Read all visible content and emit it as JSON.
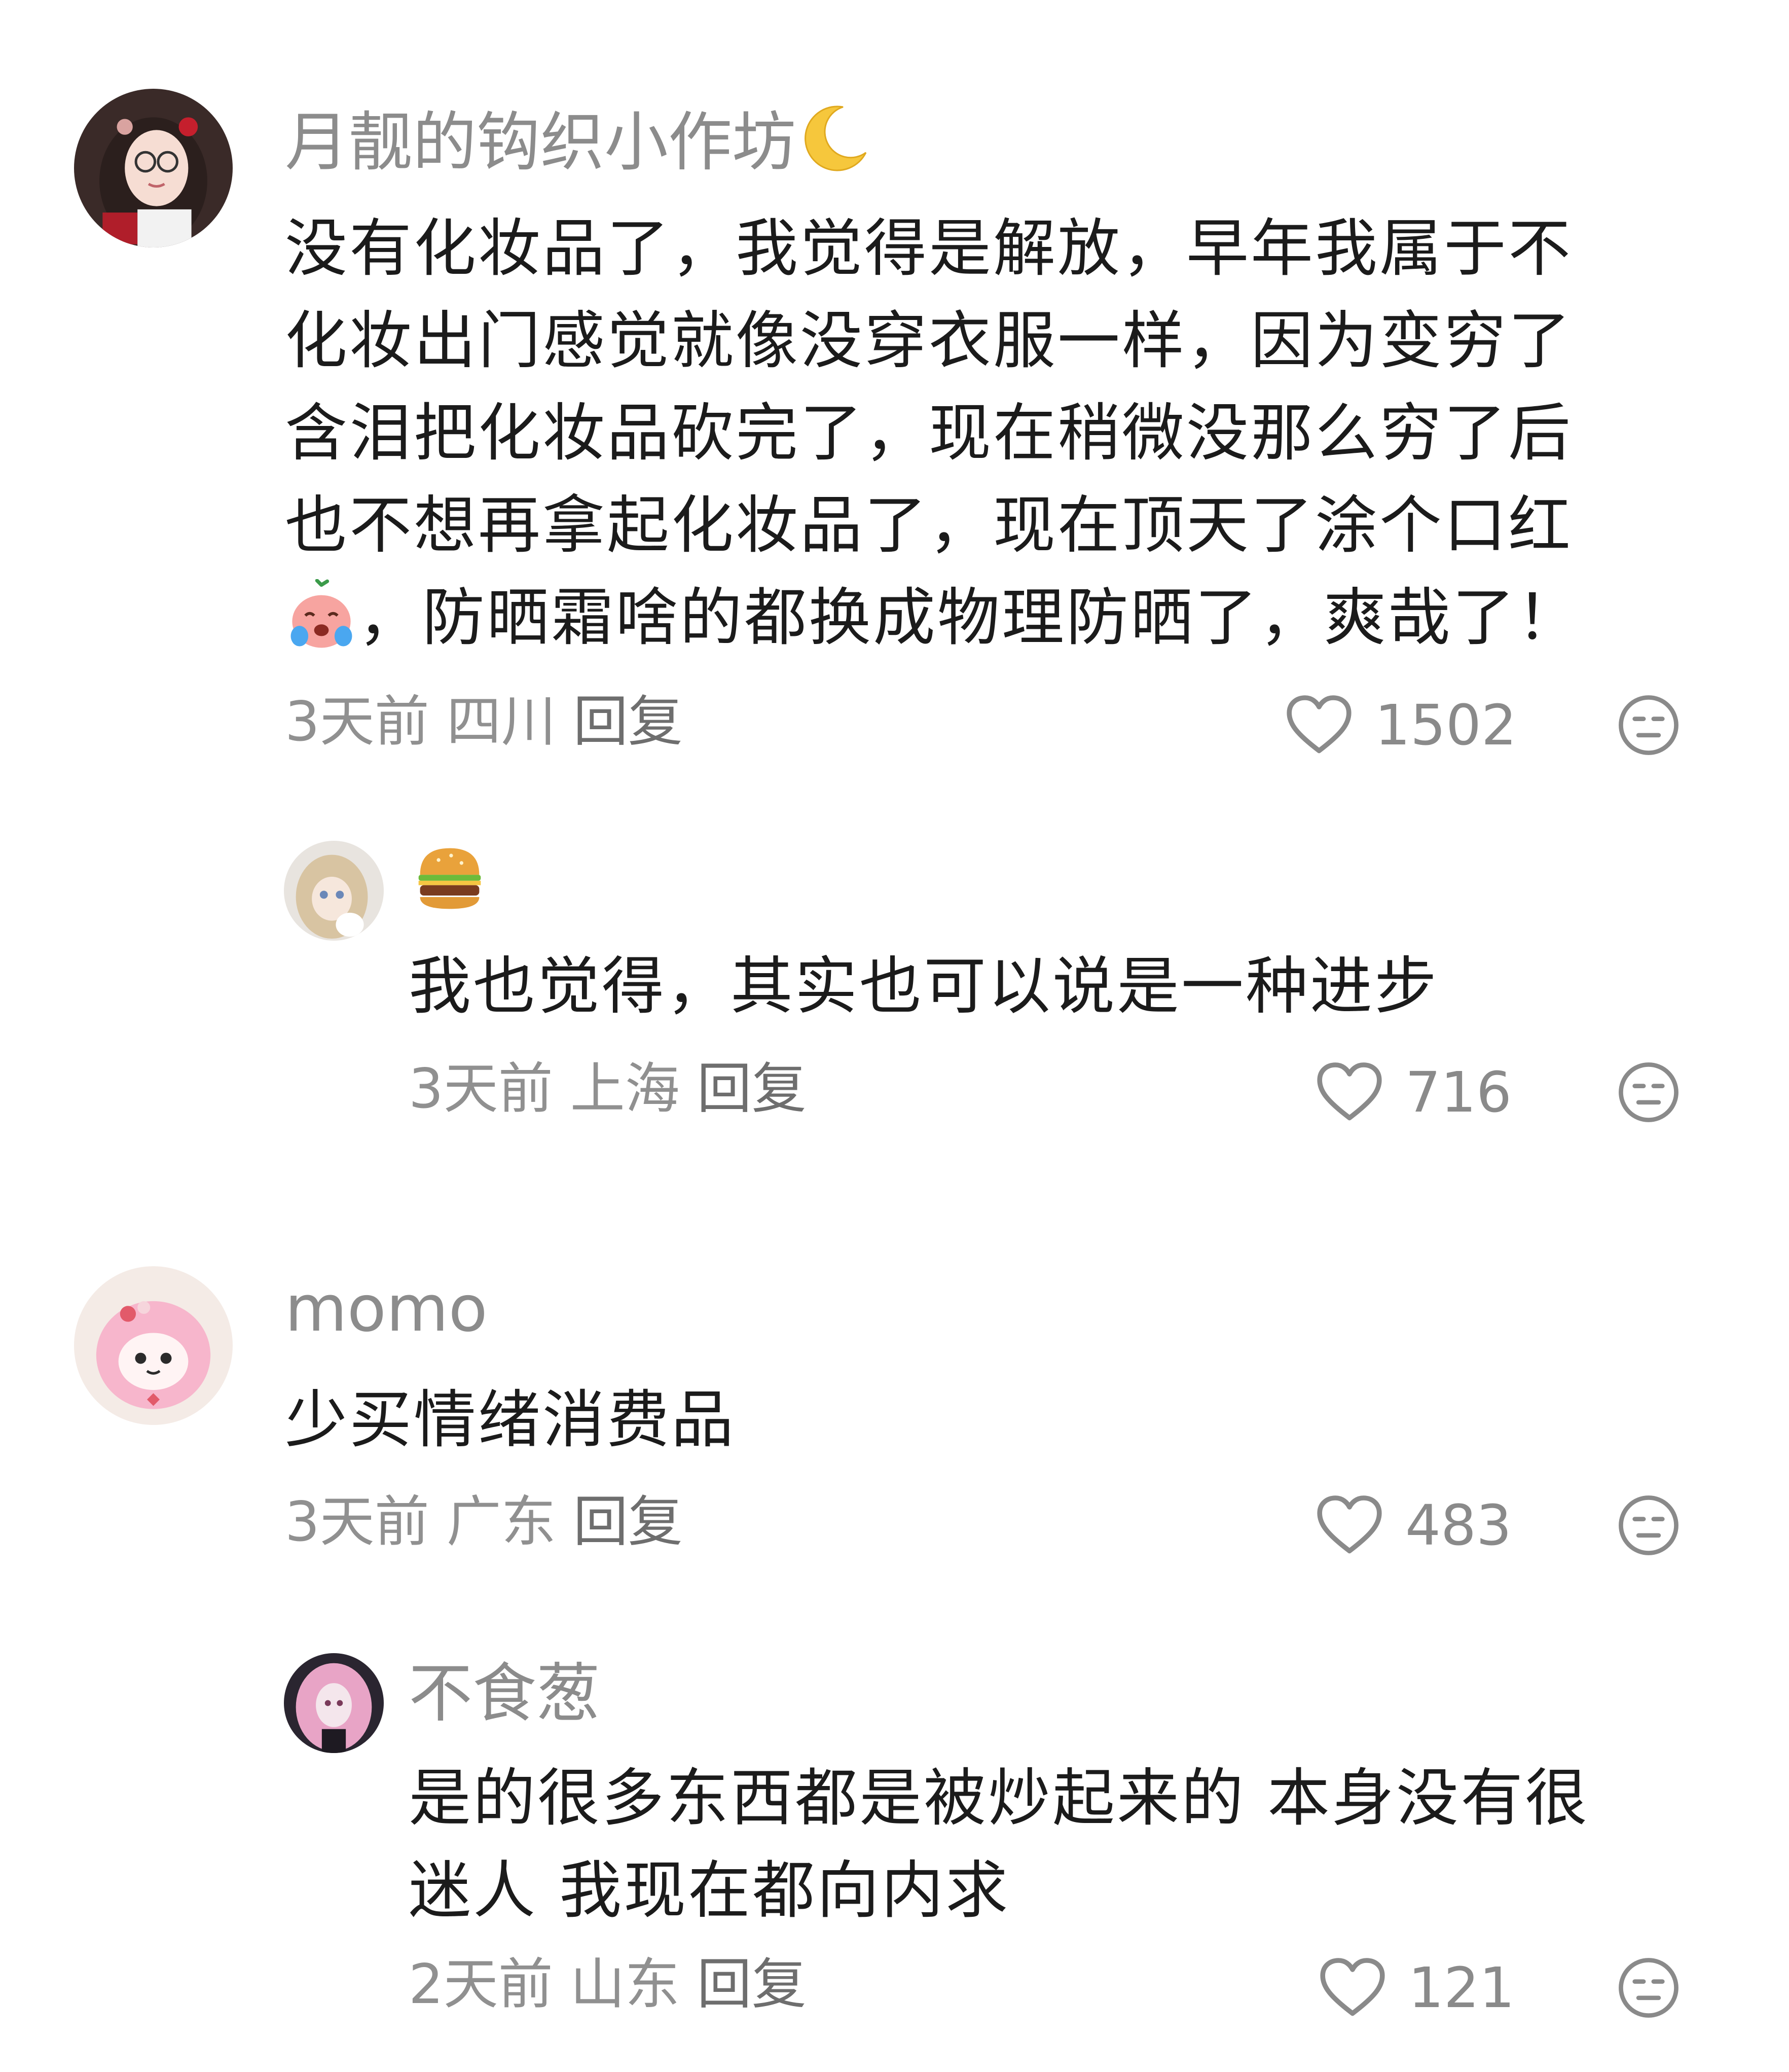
{
  "comments": [
    {
      "username": "月靓的钩织小作坊",
      "username_emoji": "moon-icon",
      "lines": [
        "没有化妆品了，我觉得是解放，早年我属于不",
        "化妆出门感觉就像没穿衣服一样，因为变穷了",
        "含泪把化妆品砍完了，现在稍微没那么穷了后",
        "也不想再拿起化妆品了，现在顶天了涂个口红"
      ],
      "last_line_emoji": "crying-peach-emoji",
      "last_line": "，防晒霜啥的都换成物理防晒了，爽哉了！",
      "time": "3天前",
      "location": "四川",
      "reply": "回复",
      "likes": "1502"
    },
    {
      "username_emoji": "hamburger-icon",
      "text": "我也觉得，其实也可以说是一种进步",
      "time": "3天前",
      "location": "上海",
      "reply": "回复",
      "likes": "716"
    },
    {
      "username": "momo",
      "text": "少买情绪消费品",
      "time": "3天前",
      "location": "广东",
      "reply": "回复",
      "likes": "483"
    },
    {
      "username": "不食葱",
      "lines": [
        "是的很多东西都是被炒起来的 本身没有很",
        "迷人 我现在都向内求"
      ],
      "time": "2天前",
      "location": "山东",
      "reply": "回复",
      "likes": "121"
    }
  ],
  "colors": {
    "username": "#8c8c8c",
    "text": "#1b1b1b",
    "meta": "#909090",
    "icon": "#8a8a8a"
  }
}
